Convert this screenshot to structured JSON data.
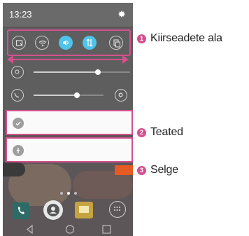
{
  "status_bar": {
    "time": "13:23"
  },
  "quick_settings": {
    "buttons": [
      {
        "icon": "screen-capture-icon",
        "active": false
      },
      {
        "icon": "wifi-icon",
        "active": false
      },
      {
        "icon": "sound-icon",
        "active": true
      },
      {
        "icon": "data-transfer-icon",
        "active": true
      },
      {
        "icon": "copy-icon",
        "active": false
      }
    ],
    "brightness_level": 0.67,
    "volume_level": 0.62
  },
  "annotations": [
    {
      "number": "1",
      "label": "Kiirseadete ala"
    },
    {
      "number": "2",
      "label": "Teated"
    },
    {
      "number": "3",
      "label": "Selge"
    }
  ],
  "colors": {
    "accent": "#d4508e",
    "toggle_on": "#4fc3e8",
    "clear_button": "#e65a23"
  }
}
